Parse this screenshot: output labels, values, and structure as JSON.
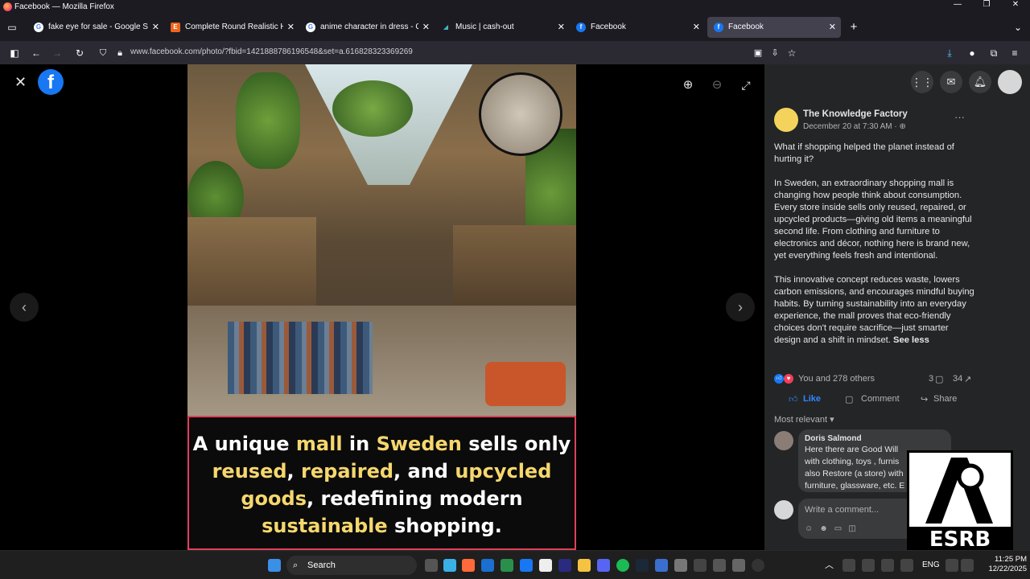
{
  "window": {
    "title": "Facebook — Mozilla Firefox",
    "minimize": "—",
    "maximize": "❐",
    "close": "✕"
  },
  "tabs": [
    {
      "label": "fake eye for sale - Google Search",
      "icon": "google-icon"
    },
    {
      "label": "Complete Round Realistic Hum",
      "icon": "etsy-icon"
    },
    {
      "label": "anime character in dress - Goog",
      "icon": "google-icon"
    },
    {
      "label": "Music | cash-out",
      "icon": "music-icon"
    },
    {
      "label": "Facebook",
      "icon": "facebook-icon"
    },
    {
      "label": "Facebook",
      "icon": "facebook-icon"
    }
  ],
  "tab_close": "✕",
  "new_tab": "+",
  "address": {
    "url": "www.facebook.com/photo/?fbid=1421888786196548&set=a.616828323369269"
  },
  "viewer": {
    "close": "✕"
  },
  "caption": {
    "w1": "A unique ",
    "w2": "mall",
    "w3": " in ",
    "w4": "Sweden",
    "w5": " sells only",
    "w6": "reused",
    "w7": ", ",
    "w8": "repaired",
    "w9": ", and ",
    "w10": "upcycled",
    "w11": "goods",
    "w12": ", redefining modern",
    "w13": "sustainable",
    "w14": " shopping."
  },
  "post": {
    "author": "The Knowledge Factory",
    "date": "December 20 at 7:30 AM · ",
    "more": "···",
    "p1": "What if shopping helped the planet instead of hurting it?",
    "p2": "In Sweden, an extraordinary shopping mall is changing how people think about consumption. Every store inside sells only reused, repaired, or upcycled products—giving old items a meaningful second life. From clothing and furniture to electronics and décor, nothing here is brand new, yet everything feels fresh and intentional.",
    "p3": "This innovative concept reduces waste, lowers carbon emissions, and encourages mindful buying habits. By turning sustainability into an everyday experience, the mall proves that eco-friendly choices don't require sacrifice—just smarter design and a shift in mindset.",
    "see_less": "See less",
    "reactions_text": "You and 278 others",
    "comments_count": "3",
    "shares_count": "34",
    "like": "Like",
    "comment": "Comment",
    "share": "Share",
    "sort": "Most relevant",
    "comment1_author": "Doris Salmond",
    "comment1_l1": "Here there are Good Will",
    "comment1_l2": "with clothing, toys , furnis",
    "comment1_l3": "also Restore (a store) with",
    "comment1_l4": "furniture, glassware, etc. E",
    "write_placeholder": "Write a comment..."
  },
  "esrb": {
    "label": "ESRB"
  },
  "taskbar": {
    "search": "Search",
    "lang": "ENG",
    "time": "11:25 PM",
    "date": "12/22/2025"
  }
}
